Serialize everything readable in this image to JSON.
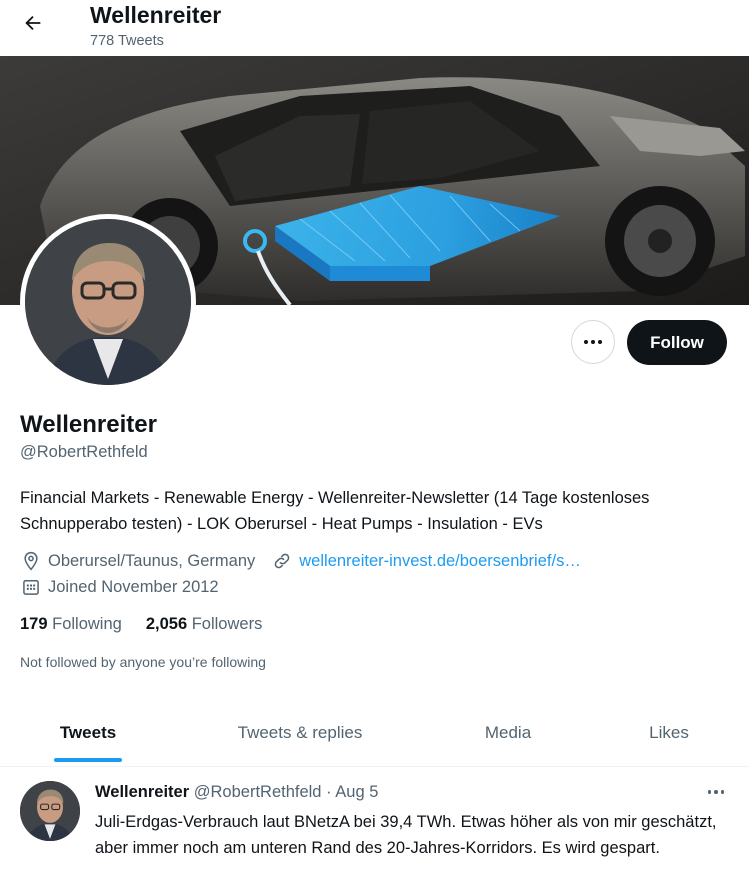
{
  "header": {
    "title": "Wellenreiter",
    "tweet_count": "778 Tweets"
  },
  "profile": {
    "name": "Wellenreiter",
    "handle": "@RobertRethfeld",
    "bio": "Financial Markets - Renewable Energy - Wellenreiter-Newsletter (14 Tage kostenloses Schnupperabo testen) - LOK Oberursel - Heat Pumps - Insulation - EVs",
    "location": "Oberursel/Taunus, Germany",
    "website": "wellenreiter-invest.de/boersenbrief/s…",
    "joined": "Joined November 2012",
    "following_count": "179",
    "following_label": "Following",
    "followers_count": "2,056",
    "followers_label": "Followers",
    "not_followed": "Not followed by anyone you’re following"
  },
  "actions": {
    "follow_label": "Follow"
  },
  "tabs": [
    {
      "label": "Tweets",
      "active": true
    },
    {
      "label": "Tweets & replies",
      "active": false
    },
    {
      "label": "Media",
      "active": false
    },
    {
      "label": "Likes",
      "active": false
    }
  ],
  "tweet": {
    "author_name": "Wellenreiter",
    "author_handle": "@RobertRethfeld",
    "separator": "·",
    "date": "Aug 5",
    "text": "Juli-Erdgas-Verbrauch laut BNetzA bei 39,4 TWh. Etwas höher als von mir geschätzt, aber immer noch am unteren Rand des 20-Jahres-Korridors. Es wird gespart."
  },
  "colors": {
    "accent": "#1d9bf0",
    "text": "#0f1419",
    "secondary": "#536471",
    "battery": "#2fb4f0"
  },
  "icons": [
    "back-arrow-icon",
    "more-dots-icon",
    "location-pin-icon",
    "link-icon",
    "calendar-icon"
  ]
}
